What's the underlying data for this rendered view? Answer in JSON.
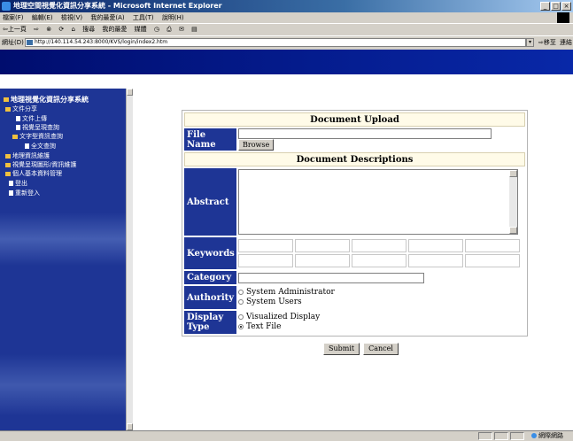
{
  "window": {
    "title": "地理空間視覺化資訊分享系統 - Microsoft Internet Explorer",
    "controls": [
      "_",
      "□",
      "×"
    ]
  },
  "menu": [
    "檔案(F)",
    "編輯(E)",
    "檢視(V)",
    "我的最愛(A)",
    "工具(T)",
    "說明(H)"
  ],
  "toolbar": [
    "⇦上一頁",
    "⇨",
    "⊗",
    "⟳",
    "⌂",
    "搜尋",
    "我的最愛",
    "媒體",
    "◷",
    "⎙",
    "✉",
    "▤"
  ],
  "address": {
    "label": "網址(D)",
    "url": "http://140.114.54.243:8000/KVS/login/index2.htm",
    "go": "移至",
    "links": "連結"
  },
  "sidebar": {
    "title": "地理視覺化資訊分享系統",
    "items": [
      {
        "label": "文件分享"
      },
      {
        "label": "文件上傳"
      },
      {
        "label": "視覺呈現查詢"
      },
      {
        "label": "文字型資訊查詢"
      },
      {
        "label": "全文查詢"
      },
      {
        "label": "地理資訊維護"
      },
      {
        "label": "視覺呈現圖形/資訊維護"
      },
      {
        "label": "個人基本資料管理"
      },
      {
        "label": "登出"
      },
      {
        "label": "重新登入"
      }
    ]
  },
  "form": {
    "title": "Document Upload",
    "file_name_label": "File Name",
    "browse": "Browse",
    "descriptions_title": "Document Descriptions",
    "abstract_label": "Abstract",
    "keywords_label": "Keywords",
    "category_label": "Category",
    "authority_label": "Authority",
    "authority_options": [
      {
        "label": "System Administrator",
        "checked": false
      },
      {
        "label": "System Users",
        "checked": false
      }
    ],
    "display_type_label": "Display Type",
    "display_options": [
      {
        "label": "Visualized Display",
        "checked": false
      },
      {
        "label": "Text File",
        "checked": true
      }
    ],
    "submit": "Submit",
    "cancel": "Cancel"
  },
  "status": {
    "zone": "網際網路"
  },
  "colors": {
    "sidebar": "#1e3595",
    "label_bg": "#1e3595",
    "header_bg": "#fffbe8"
  }
}
